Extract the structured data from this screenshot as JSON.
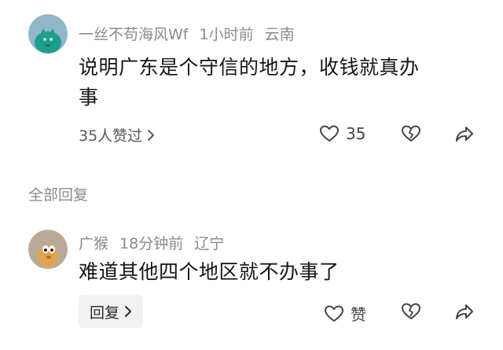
{
  "comment1": {
    "username": "一丝不苟海风Wf",
    "time": "1小时前",
    "location": "云南",
    "text_line1": "说明广东是个守信的地方，收钱就真办",
    "text_line2": "事",
    "likes_link": "35人赞过",
    "like_count": "35"
  },
  "section": {
    "title": "全部回复"
  },
  "comment2": {
    "username": "广猴",
    "time": "18分钟前",
    "location": "辽宁",
    "text": "难道其他四个地区就不办事了",
    "reply_label": "回复",
    "like_label": "赞"
  },
  "icons": {
    "like": "heart-outline-icon",
    "dislike": "broken-heart-icon",
    "share": "share-arrow-icon",
    "chevron": "chevron-right-icon"
  },
  "colors": {
    "avatar1_bg": "#8fb7c8",
    "avatar1_fg": "#1d9e8a",
    "avatar2_bg": "#b9aa97",
    "avatar2_fg": "#e2a250",
    "meta_text": "#8a8a8a"
  }
}
